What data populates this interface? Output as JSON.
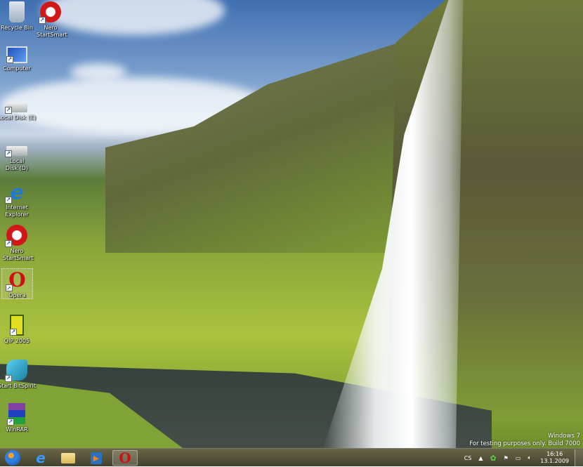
{
  "desktop_icons": [
    {
      "label": "Recycle Bin",
      "icon": "recycle-bin-icon"
    },
    {
      "label": "Nero StartSmart",
      "icon": "nero-icon"
    },
    {
      "label": "Computer",
      "icon": "computer-icon"
    },
    {
      "label": "Local Disk (E)",
      "icon": "hard-disk-icon"
    },
    {
      "label": "Local Disk (D)",
      "icon": "hard-disk-icon"
    },
    {
      "label": "Internet Explorer",
      "icon": "internet-explorer-icon"
    },
    {
      "label": "Nero StartSmart",
      "icon": "nero-icon"
    },
    {
      "label": "Opera",
      "icon": "opera-icon"
    },
    {
      "label": "QIP 2005",
      "icon": "qip-icon"
    },
    {
      "label": "Start BitSpirit",
      "icon": "bitspirit-icon"
    },
    {
      "label": "WinRAR",
      "icon": "winrar-icon"
    }
  ],
  "watermark": {
    "line1": "Windows 7",
    "line2": "For testing purposes only. Build 7000"
  },
  "taskbar": {
    "pinned": [
      "start-orb",
      "internet-explorer",
      "windows-explorer",
      "media-player",
      "opera"
    ],
    "language": "CS",
    "time": "16:16",
    "date": "13.1.2009"
  }
}
